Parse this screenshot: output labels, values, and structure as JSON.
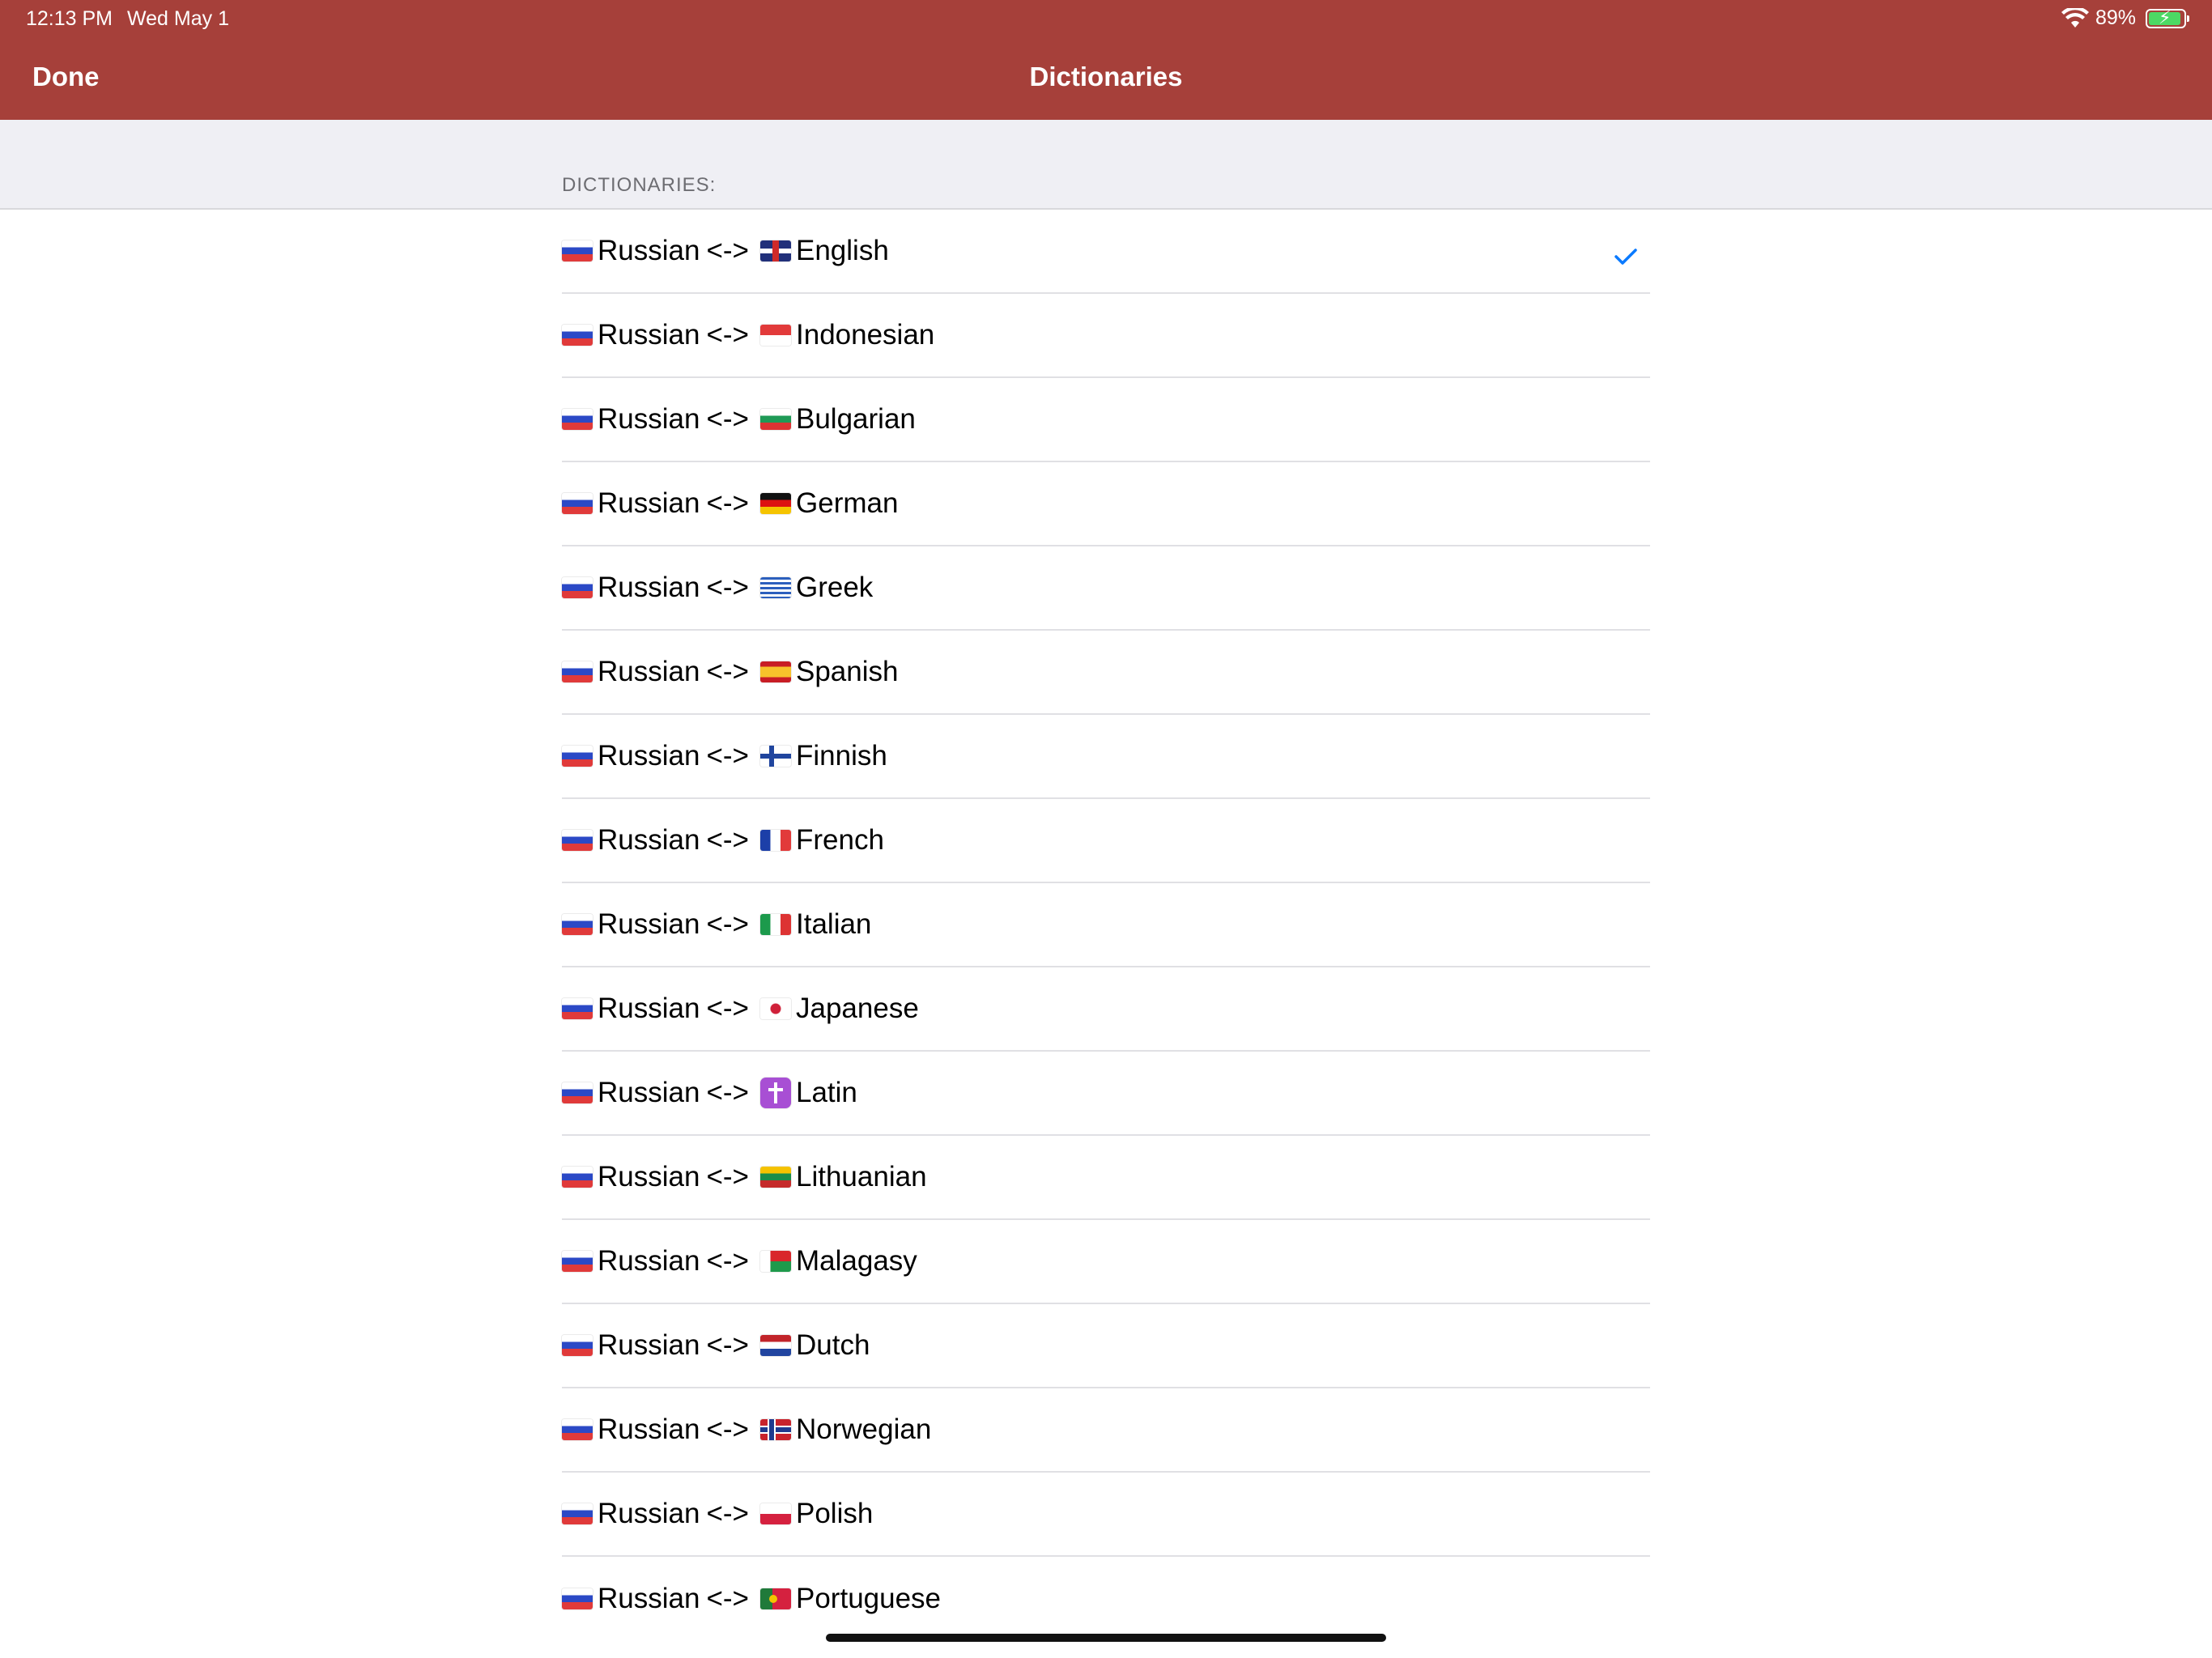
{
  "status_bar": {
    "time": "12:13 PM",
    "date": "Wed May 1",
    "battery": "89%"
  },
  "nav": {
    "done_label": "Done",
    "title": "Dictionaries"
  },
  "section": {
    "header": "DICTIONARIES:"
  },
  "dictionaries": [
    {
      "from": "Russian",
      "sep": "<->",
      "to": "English",
      "flag_from": "ru",
      "flag_to": "gb",
      "selected": true
    },
    {
      "from": "Russian",
      "sep": "<->",
      "to": "Indonesian",
      "flag_from": "ru",
      "flag_to": "id",
      "selected": false
    },
    {
      "from": "Russian",
      "sep": "<->",
      "to": "Bulgarian",
      "flag_from": "ru",
      "flag_to": "bg",
      "selected": false
    },
    {
      "from": "Russian",
      "sep": "<->",
      "to": "German",
      "flag_from": "ru",
      "flag_to": "de",
      "selected": false
    },
    {
      "from": "Russian",
      "sep": "<->",
      "to": "Greek",
      "flag_from": "ru",
      "flag_to": "gr",
      "selected": false
    },
    {
      "from": "Russian",
      "sep": "<->",
      "to": "Spanish",
      "flag_from": "ru",
      "flag_to": "es",
      "selected": false
    },
    {
      "from": "Russian",
      "sep": "<->",
      "to": "Finnish",
      "flag_from": "ru",
      "flag_to": "fi",
      "selected": false
    },
    {
      "from": "Russian",
      "sep": "<->",
      "to": "French",
      "flag_from": "ru",
      "flag_to": "fr",
      "selected": false
    },
    {
      "from": "Russian",
      "sep": "<->",
      "to": "Italian",
      "flag_from": "ru",
      "flag_to": "it",
      "selected": false
    },
    {
      "from": "Russian",
      "sep": "<->",
      "to": "Japanese",
      "flag_from": "ru",
      "flag_to": "jp",
      "selected": false
    },
    {
      "from": "Russian",
      "sep": "<->",
      "to": "Latin",
      "flag_from": "ru",
      "flag_to": "la",
      "selected": false
    },
    {
      "from": "Russian",
      "sep": "<->",
      "to": "Lithuanian",
      "flag_from": "ru",
      "flag_to": "lt",
      "selected": false
    },
    {
      "from": "Russian",
      "sep": "<->",
      "to": "Malagasy",
      "flag_from": "ru",
      "flag_to": "mg",
      "selected": false
    },
    {
      "from": "Russian",
      "sep": "<->",
      "to": "Dutch",
      "flag_from": "ru",
      "flag_to": "nl",
      "selected": false
    },
    {
      "from": "Russian",
      "sep": "<->",
      "to": "Norwegian",
      "flag_from": "ru",
      "flag_to": "no",
      "selected": false
    },
    {
      "from": "Russian",
      "sep": "<->",
      "to": "Polish",
      "flag_from": "ru",
      "flag_to": "pl",
      "selected": false
    },
    {
      "from": "Russian",
      "sep": "<->",
      "to": "Portuguese",
      "flag_from": "ru",
      "flag_to": "pt",
      "selected": false
    }
  ],
  "colors": {
    "nav_background": "#a6403a",
    "checkmark": "#0a7aff",
    "section_background": "#efeff4"
  },
  "icons": {
    "selected": "checkmark-icon",
    "wifi": "wifi-icon",
    "battery": "battery-charging-icon"
  }
}
